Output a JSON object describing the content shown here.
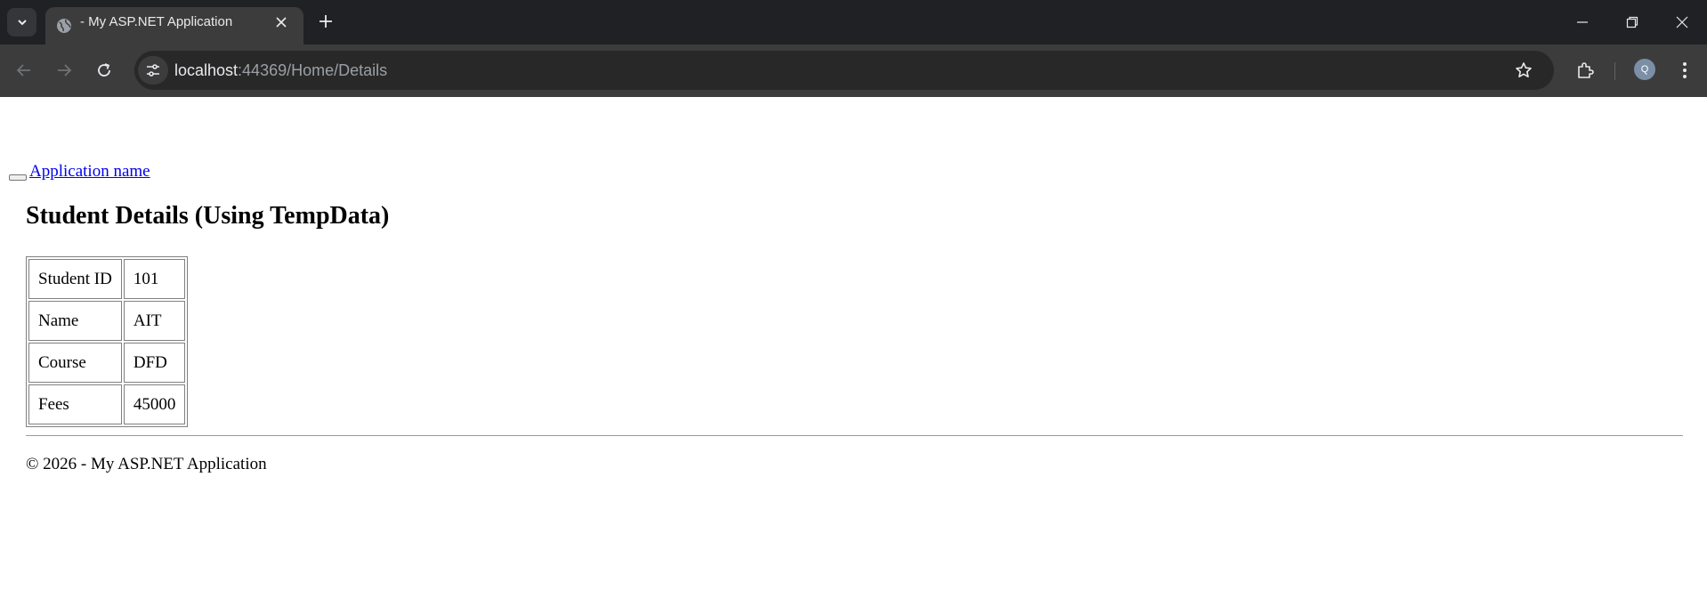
{
  "browser": {
    "tab_title": "- My ASP.NET Application",
    "url_host": "localhost",
    "url_rest": ":44369/Home/Details",
    "profile_initial": "Q"
  },
  "page": {
    "brand": "Application name",
    "heading": "Student Details (Using TempData)",
    "rows": [
      {
        "label": "Student ID",
        "value": "101"
      },
      {
        "label": "Name",
        "value": "AIT"
      },
      {
        "label": "Course",
        "value": "DFD"
      },
      {
        "label": "Fees",
        "value": "45000"
      }
    ],
    "footer": "© 2026 - My ASP.NET Application"
  },
  "colors": {
    "tabstrip": "#202124",
    "toolbar": "#3c3c3c",
    "link": "#0000ee"
  }
}
